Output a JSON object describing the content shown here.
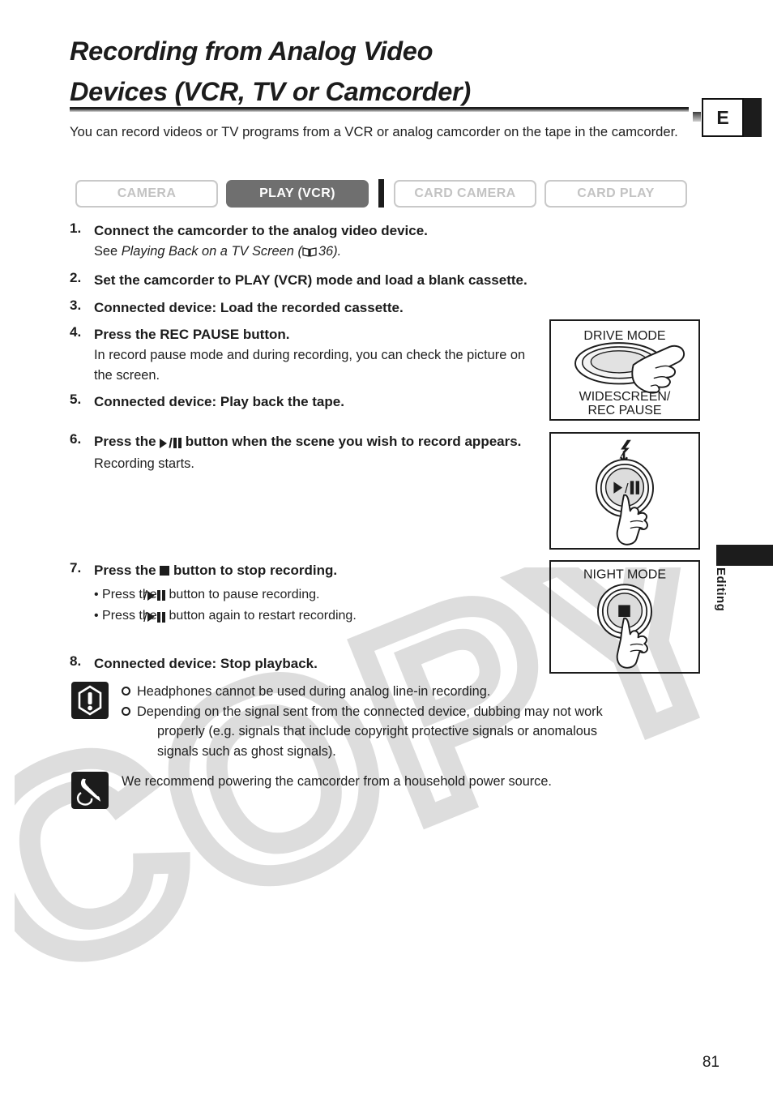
{
  "page": {
    "number": "81",
    "language_marker": "E",
    "side_tab": "Editing",
    "watermark": "COPY"
  },
  "header": {
    "title_line1": "Recording from Analog Video",
    "title_line2": "Devices (VCR, TV or Camcorder)",
    "intro": "You can record videos or TV programs from a VCR or analog camcorder on the tape in the camcorder."
  },
  "modes": {
    "camera": "CAMERA",
    "play_vcr": "PLAY (VCR)",
    "card_camera": "CARD CAMERA",
    "card_play": "CARD PLAY",
    "active": "PLAY (VCR)"
  },
  "steps": {
    "s1": {
      "num": "1.",
      "title": "Connect the camcorder to the analog video device.",
      "sub_pre": "See ",
      "sub_italic": "Playing Back on a TV Screen",
      "sub_open": " (",
      "page_ref": "36",
      "sub_close": ")."
    },
    "s2": {
      "num": "2.",
      "title": "Set the camcorder to PLAY (VCR) mode and load a blank cassette."
    },
    "s3": {
      "num": "3.",
      "title": "Connected device: Load the recorded cassette."
    },
    "s4": {
      "num": "4.",
      "title": "Press the REC PAUSE button.",
      "sub": "In record pause mode and during recording, you can check the picture on the screen."
    },
    "s5": {
      "num": "5.",
      "title": "Connected device: Play back the tape."
    },
    "s6": {
      "num": "6.",
      "title_pre": "Press the ",
      "title_post": " button when the scene you wish to record appears.",
      "sub": "Recording starts."
    },
    "s7": {
      "num": "7.",
      "title_pre": "Press the ",
      "title_post": " button to stop recording.",
      "bullet1_pre": "• Press the ",
      "bullet1_post": " button to pause recording.",
      "bullet2_pre": "• Press the ",
      "bullet2_post": " button again to restart recording."
    },
    "s8": {
      "num": "8.",
      "title": "Connected device: Stop playback."
    }
  },
  "illustrations": {
    "box1": {
      "label_top": "DRIVE MODE",
      "label_bottom_line1": "WIDESCREEN/",
      "label_bottom_line2": "REC PAUSE"
    },
    "box2": {
      "button_glyph": "play-pause"
    },
    "box3": {
      "label_top": "NIGHT MODE",
      "button_glyph": "stop"
    }
  },
  "notes": {
    "warning": {
      "item1": "Headphones cannot be used during analog line-in recording.",
      "item2_line1": "Depending on the signal sent from the connected device, dubbing may not work",
      "item2_line2": "properly (e.g. signals that include copyright protective signals or anomalous",
      "item2_line3": "signals such as ghost signals)."
    },
    "memo": {
      "text": "We recommend powering the camcorder from a household power source."
    }
  },
  "colors": {
    "ink": "#1c1c1c",
    "active_mode_bg": "#6f6f6f",
    "inactive_mode_text": "#c3c3c3",
    "watermark": "#dcdcdc"
  }
}
